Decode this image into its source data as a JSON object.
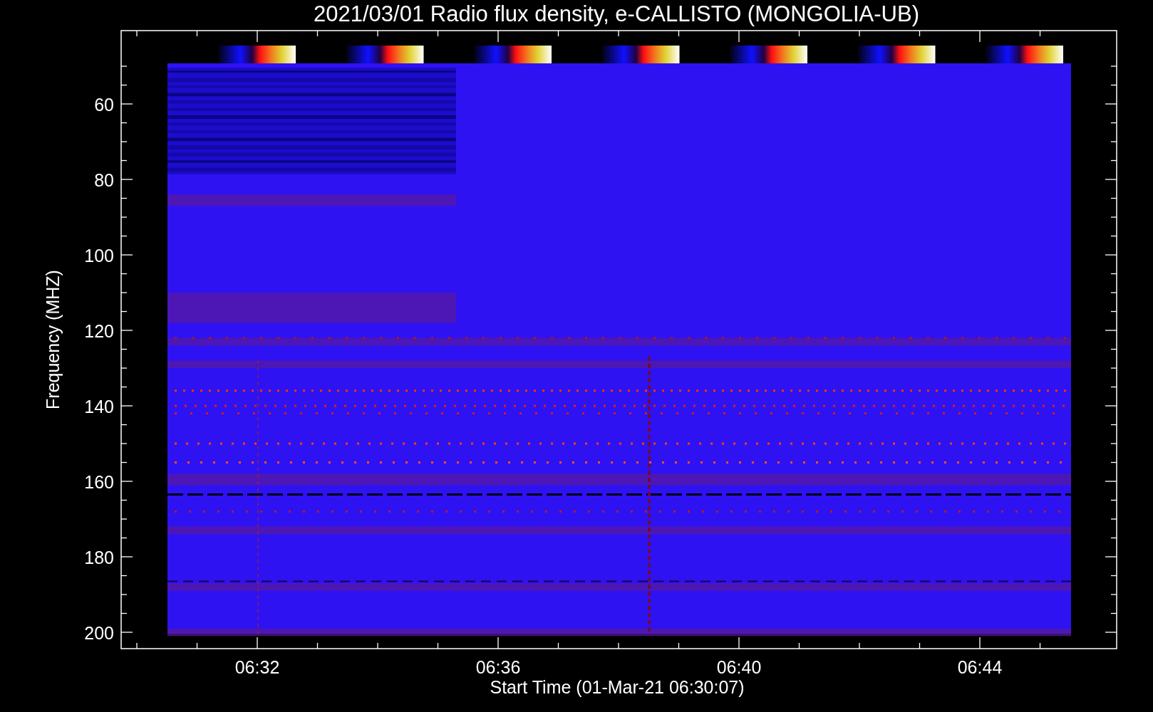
{
  "title": "2021/03/01  Radio flux density, e-CALLISTO (MONGOLIA-UB)",
  "y_axis": {
    "title": "Frequency (MHZ)",
    "tick_labels": [
      "60",
      "80",
      "100",
      "120",
      "140",
      "160",
      "180",
      "200"
    ]
  },
  "x_axis": {
    "title": "Start Time (01-Mar-21 06:30:07)",
    "tick_labels": [
      "06:32",
      "06:36",
      "06:40",
      "06:44"
    ]
  }
}
